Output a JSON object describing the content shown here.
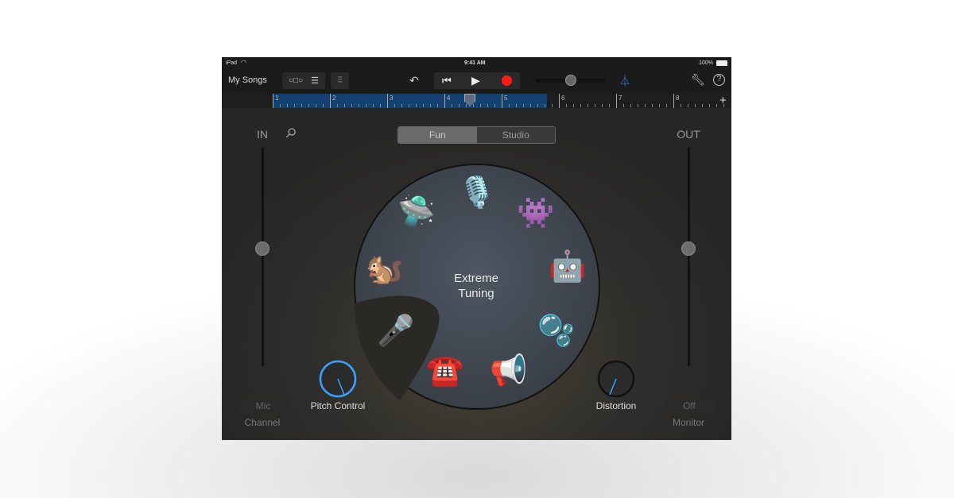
{
  "status": {
    "device": "iPad",
    "time": "9:41 AM",
    "battery": "100%"
  },
  "toolbar": {
    "my_songs": "My Songs",
    "icons": [
      "track-view-icon",
      "tracks-list-icon",
      "mixer-icon",
      "undo-icon",
      "rewind-icon",
      "play-icon",
      "record-icon",
      "metronome-icon",
      "wrench-icon",
      "help-icon"
    ],
    "record_color": "#ff1a1a",
    "accent": "#2f7de1",
    "volume": 0.5
  },
  "ruler": {
    "bars": [
      "1",
      "2",
      "3",
      "4",
      "5",
      "6",
      "7",
      "8"
    ],
    "add": "+",
    "playhead_bar": 4.35
  },
  "mode": {
    "fun": "Fun",
    "studio": "Studio",
    "selected": "Fun"
  },
  "input": {
    "label": "IN",
    "level": 0.5,
    "channel_value": "Mic",
    "channel_label": "Channel"
  },
  "output": {
    "label": "OUT",
    "level": 0.5,
    "monitor_value": "Off",
    "monitor_label": "Monitor"
  },
  "wheel": {
    "title_line1": "Extreme",
    "title_line2": "Tuning",
    "voices": [
      "microphone",
      "monster",
      "robot",
      "bubbles",
      "megaphone",
      "telephone",
      "extreme-tuning-mic",
      "squirrel",
      "alien-ufo"
    ],
    "selected": "extreme-tuning-mic"
  },
  "knobs": {
    "pitch": "Pitch Control",
    "distortion": "Distortion"
  }
}
